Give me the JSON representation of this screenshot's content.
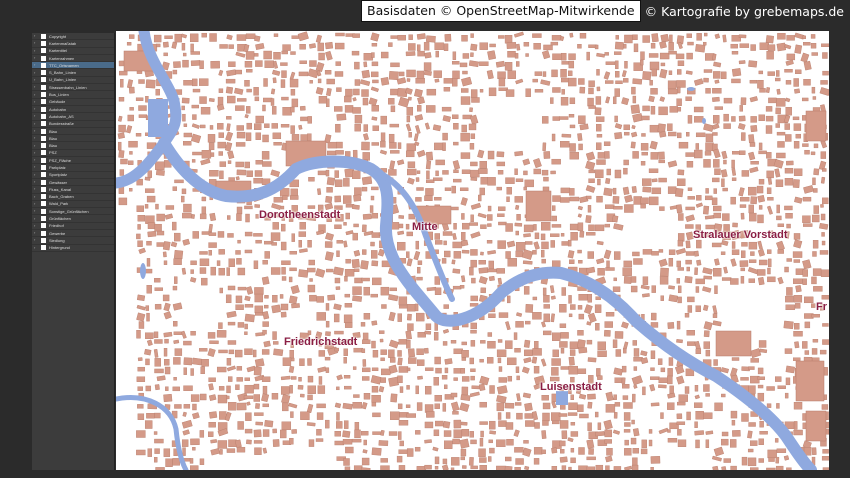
{
  "credits": {
    "basisdaten": "Basisdaten © OpenStreetMap-Mitwirkende",
    "kartografie": "© Kartografie by grebemaps.de"
  },
  "layers": [
    {
      "label": "Copyright",
      "selected": false
    },
    {
      "label": "Kartenmaßstab",
      "selected": false
    },
    {
      "label": "Kartentitel",
      "selected": false
    },
    {
      "label": "Kartenrahmen",
      "selected": false
    },
    {
      "label": "TTC_Ortsnamen",
      "selected": true
    },
    {
      "label": "S_Bahn_Linien",
      "selected": false
    },
    {
      "label": "U_Bahn_Linien",
      "selected": false
    },
    {
      "label": "Strassenbahn_Linien",
      "selected": false
    },
    {
      "label": "Bus_Linien",
      "selected": false
    },
    {
      "label": "Gebäude",
      "selected": false
    },
    {
      "label": "Autobahn",
      "selected": false
    },
    {
      "label": "Autobahn_AS",
      "selected": false
    },
    {
      "label": "Bundesstraße",
      "selected": false
    },
    {
      "label": "Blau",
      "selected": false
    },
    {
      "label": "Blau",
      "selected": false
    },
    {
      "label": "Blau",
      "selected": false
    },
    {
      "label": "PSZ",
      "selected": false
    },
    {
      "label": "PSZ_Fläche",
      "selected": false
    },
    {
      "label": "Parkplatz",
      "selected": false
    },
    {
      "label": "Sportplatz",
      "selected": false
    },
    {
      "label": "Gewässer",
      "selected": false
    },
    {
      "label": "Fluss_Kanal",
      "selected": false
    },
    {
      "label": "Bach_Graben",
      "selected": false
    },
    {
      "label": "Wald_Park",
      "selected": false
    },
    {
      "label": "Sonstige_Grünflächen",
      "selected": false
    },
    {
      "label": "Grünflächen",
      "selected": false
    },
    {
      "label": "Friedhof",
      "selected": false
    },
    {
      "label": "Gewerbe",
      "selected": false
    },
    {
      "label": "Siedlung",
      "selected": false
    },
    {
      "label": "Hintergrund",
      "selected": false
    }
  ],
  "map": {
    "colors": {
      "water": "#8fa9df",
      "building": "#d49a88",
      "building_stroke": "#b87d6b",
      "background": "#ffffff",
      "label": "#8a1e44"
    },
    "places": [
      "Dorotheenstadt",
      "Mitte",
      "Stralauer Vorstadt",
      "Friedrichstadt",
      "Luisenstadt",
      "Fr"
    ]
  }
}
